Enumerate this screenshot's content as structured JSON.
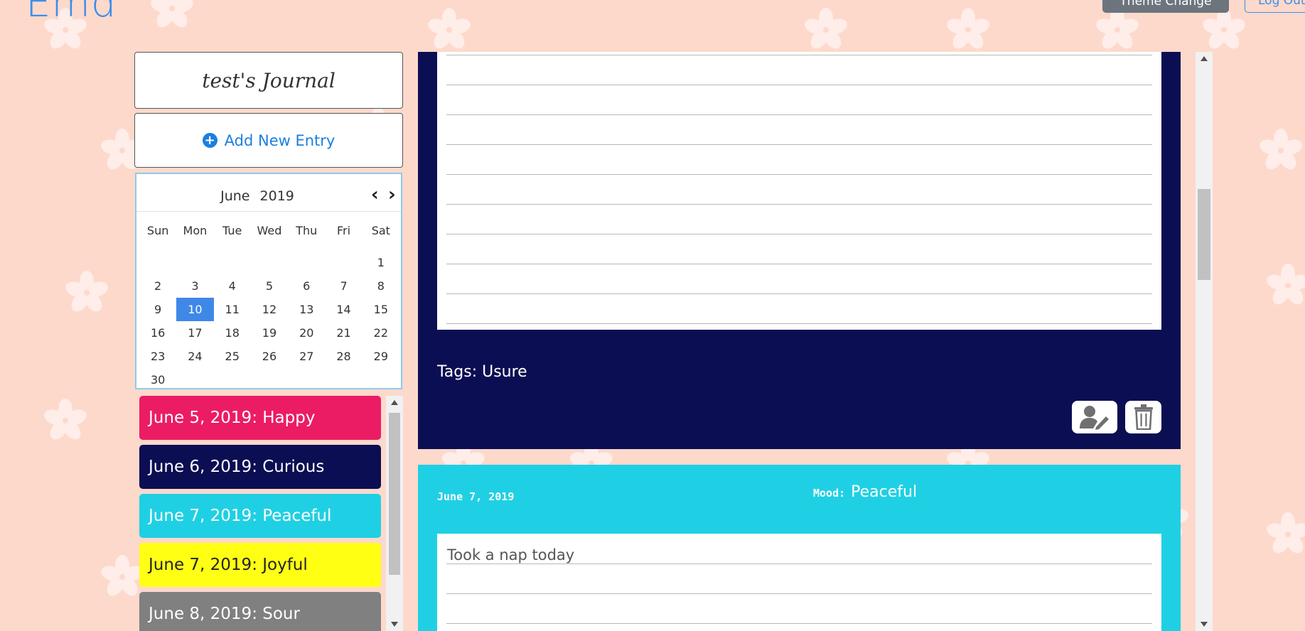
{
  "header": {
    "brand": "Emd",
    "theme_button": "Theme Change",
    "logout_button": "Log Out"
  },
  "sidebar": {
    "journal_title": "test's Journal",
    "add_entry_label": "Add New Entry",
    "calendar": {
      "month": "June",
      "year": "2019",
      "weekdays": [
        "Sun",
        "Mon",
        "Tue",
        "Wed",
        "Thu",
        "Fri",
        "Sat"
      ],
      "weeks": [
        [
          "",
          "",
          "",
          "",
          "",
          "",
          "1"
        ],
        [
          "2",
          "3",
          "4",
          "5",
          "6",
          "7",
          "8"
        ],
        [
          "9",
          "10",
          "11",
          "12",
          "13",
          "14",
          "15"
        ],
        [
          "16",
          "17",
          "18",
          "19",
          "20",
          "21",
          "22"
        ],
        [
          "23",
          "24",
          "25",
          "26",
          "27",
          "28",
          "29"
        ],
        [
          "30",
          "",
          "",
          "",
          "",
          "",
          ""
        ]
      ],
      "selected_day": "10"
    },
    "entries": [
      {
        "label": "June 5, 2019: Happy",
        "bg": "#ec1c64",
        "fg": "#ffffff"
      },
      {
        "label": "June 6, 2019: Curious",
        "bg": "#0b0e52",
        "fg": "#ffffff"
      },
      {
        "label": "June 7, 2019: Peaceful",
        "bg": "#1fd0e4",
        "fg": "#ffffff"
      },
      {
        "label": "June 7, 2019: Joyful",
        "bg": "#ffff14",
        "fg": "#222222"
      },
      {
        "label": "June 8, 2019: Sour",
        "bg": "#808080",
        "fg": "#ffffff"
      }
    ]
  },
  "main": {
    "card1": {
      "tags_label": "Tags: Usure",
      "color": "#0b0e52"
    },
    "card2": {
      "date": "June 7, 2019",
      "mood_key": "Mood:",
      "mood_value": "Peaceful",
      "text": "Took a nap today",
      "color": "#1fd0e4"
    }
  },
  "colors": {
    "background": "#fdd9cc",
    "accent": "#1a7fe0"
  }
}
